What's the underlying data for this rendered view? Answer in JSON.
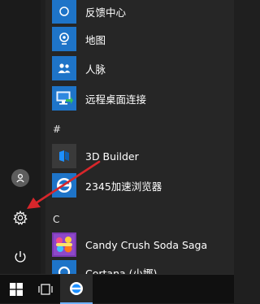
{
  "sections": {
    "hash": "#",
    "c": "C"
  },
  "apps": [
    {
      "label": "反馈中心",
      "icon": "feedback-hub-icon"
    },
    {
      "label": "地图",
      "icon": "maps-icon"
    },
    {
      "label": "人脉",
      "icon": "people-icon"
    },
    {
      "label": "远程桌面连接",
      "icon": "remote-desktop-icon"
    },
    {
      "label": "3D Builder",
      "icon": "3d-builder-icon"
    },
    {
      "label": "2345加速浏览器",
      "icon": "browser-2345-icon"
    },
    {
      "label": "Candy Crush Soda Saga",
      "icon": "candy-crush-icon"
    },
    {
      "label": "Cortana (小娜)",
      "icon": "cortana-icon"
    }
  ],
  "colors": {
    "tile_blue": "#1e74c8",
    "arrow_red": "#d8262b",
    "taskbar": "#101010"
  }
}
